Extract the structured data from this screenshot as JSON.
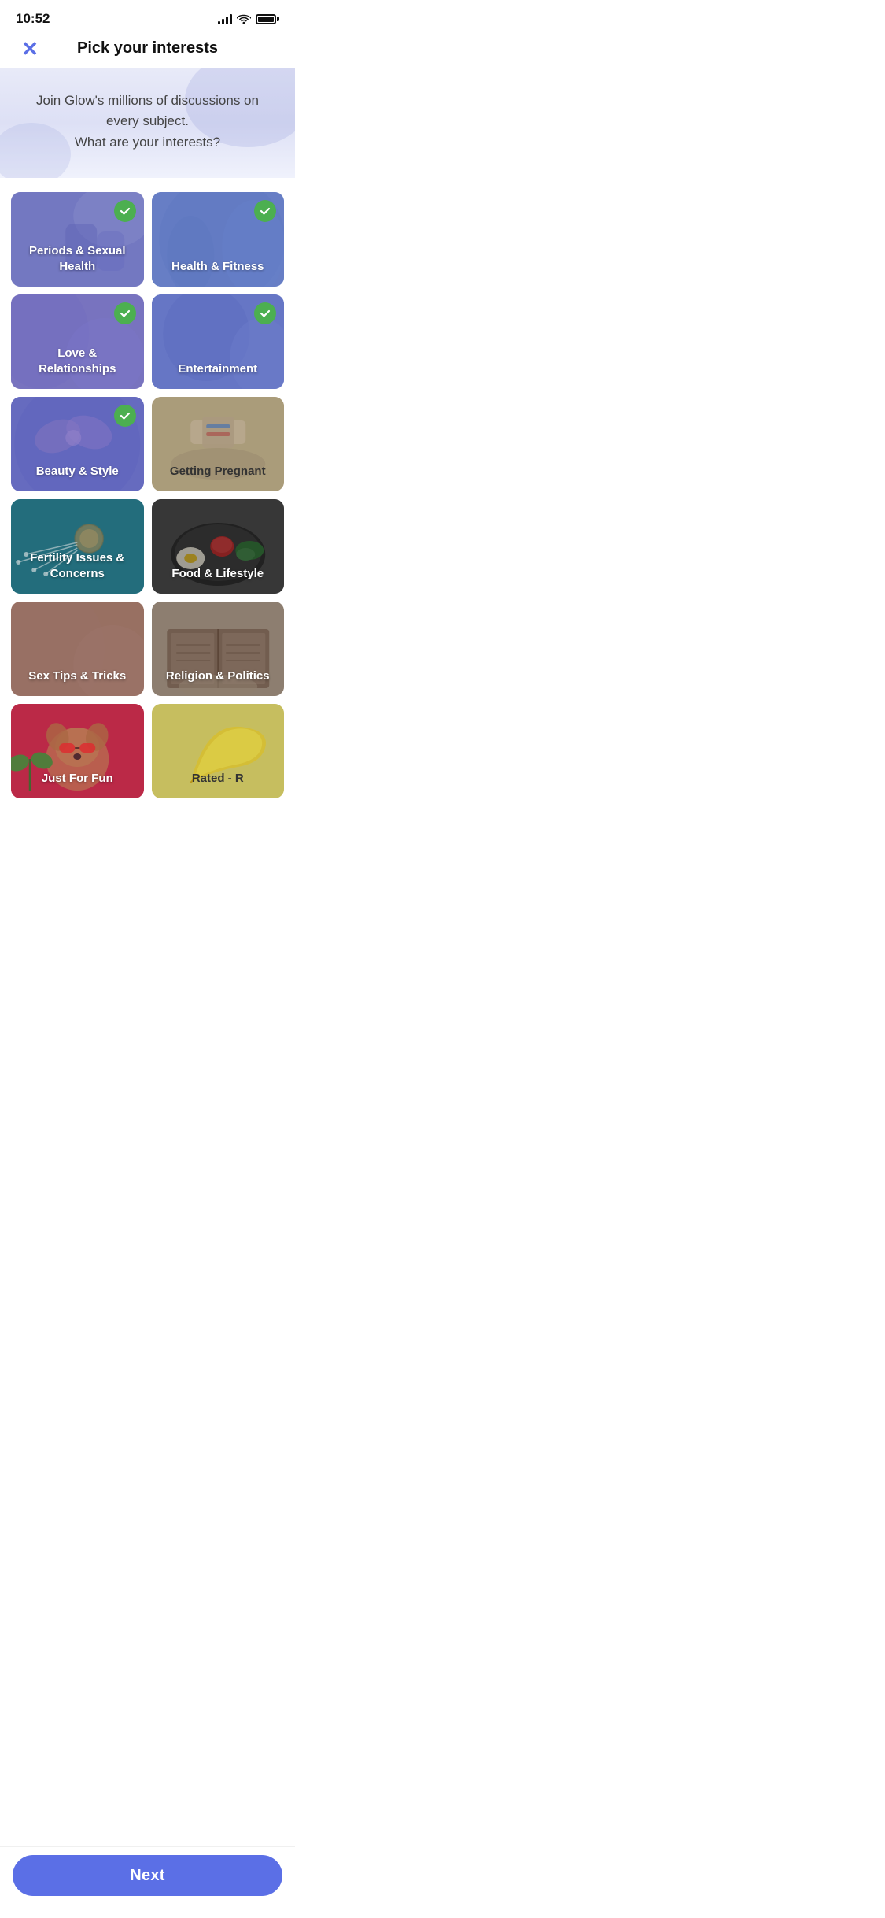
{
  "statusBar": {
    "time": "10:52"
  },
  "header": {
    "closeLabel": "✕",
    "title": "Pick your interests"
  },
  "hero": {
    "text": "Join Glow's millions of discussions on every subject.\nWhat are your interests?"
  },
  "cards": [
    {
      "id": "periods",
      "label": "Periods & Sexual Health",
      "checked": true,
      "theme": "purple"
    },
    {
      "id": "health",
      "label": "Health & Fitness",
      "checked": true,
      "theme": "blue"
    },
    {
      "id": "love",
      "label": "Love & Relationships",
      "checked": true,
      "theme": "violet"
    },
    {
      "id": "entertainment",
      "label": "Entertainment",
      "checked": true,
      "theme": "entertainment"
    },
    {
      "id": "beauty",
      "label": "Beauty & Style",
      "checked": true,
      "theme": "beauty"
    },
    {
      "id": "getting",
      "label": "Getting Pregnant",
      "checked": false,
      "theme": "getting"
    },
    {
      "id": "fertility",
      "label": "Fertility Issues & Concerns",
      "checked": false,
      "theme": "fertility"
    },
    {
      "id": "food",
      "label": "Food & Lifestyle",
      "checked": false,
      "theme": "food"
    },
    {
      "id": "sex-tips",
      "label": "Sex Tips & Tricks",
      "checked": false,
      "theme": "sex-tips"
    },
    {
      "id": "religion",
      "label": "Religion & Politics",
      "checked": false,
      "theme": "religion"
    },
    {
      "id": "fun",
      "label": "Just For Fun",
      "checked": false,
      "theme": "fun"
    },
    {
      "id": "rated",
      "label": "Rated - R",
      "checked": false,
      "theme": "rated"
    }
  ],
  "nextButton": {
    "label": "Next"
  }
}
